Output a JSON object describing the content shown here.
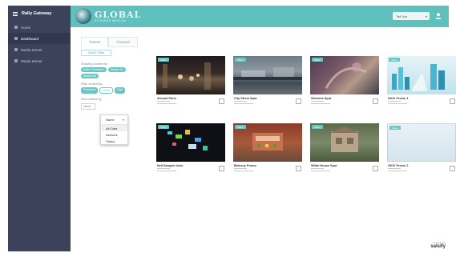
{
  "app": {
    "name": "Rally Gateway"
  },
  "sidebar": {
    "items": [
      {
        "label": "Home"
      },
      {
        "label": "Dashboard"
      },
      {
        "label": "Media Server"
      },
      {
        "label": "Media Server"
      }
    ]
  },
  "topbar": {
    "logo_big": "GLOBAL",
    "logo_small": "STORAGE MEDIUM",
    "user_label": "Ted Jon"
  },
  "tabs": [
    {
      "label": "Tweets"
    },
    {
      "label": "Channel"
    }
  ],
  "filter": {
    "sort_button": "Sort & Filter",
    "section1_label": "Showing content for",
    "section1_chips": [
      "Entire Conference",
      "Session A1",
      "Session B2"
    ],
    "section2_label": "Filter content by",
    "section2_chips": [
      "Presenters",
      "Venue",
      "Date"
    ],
    "section3_label": "Sort content by",
    "sort_value": "Name"
  },
  "dropdown": {
    "current": "Name",
    "options": [
      "Air Date",
      "Network",
      "Status"
    ]
  },
  "cards": [
    {
      "title": "Around Paris",
      "tag": "Video"
    },
    {
      "title": "City Street Spot",
      "tag": "Video"
    },
    {
      "title": "Silverine Spot",
      "tag": "Video"
    },
    {
      "title": "GKIV Promo 1",
      "tag": "Video"
    },
    {
      "title": "Neil Sampler Intro",
      "tag": "Video"
    },
    {
      "title": "Balcony Promo",
      "tag": "Video"
    },
    {
      "title": "White House Spot",
      "tag": "Video"
    },
    {
      "title": "GKIV Promo 2",
      "tag": "Video"
    }
  ],
  "footer": {
    "powered": "Powered by",
    "brand": "salsify"
  },
  "colors": {
    "accent": "#5fc0bd",
    "sidebar": "#3c4259"
  }
}
